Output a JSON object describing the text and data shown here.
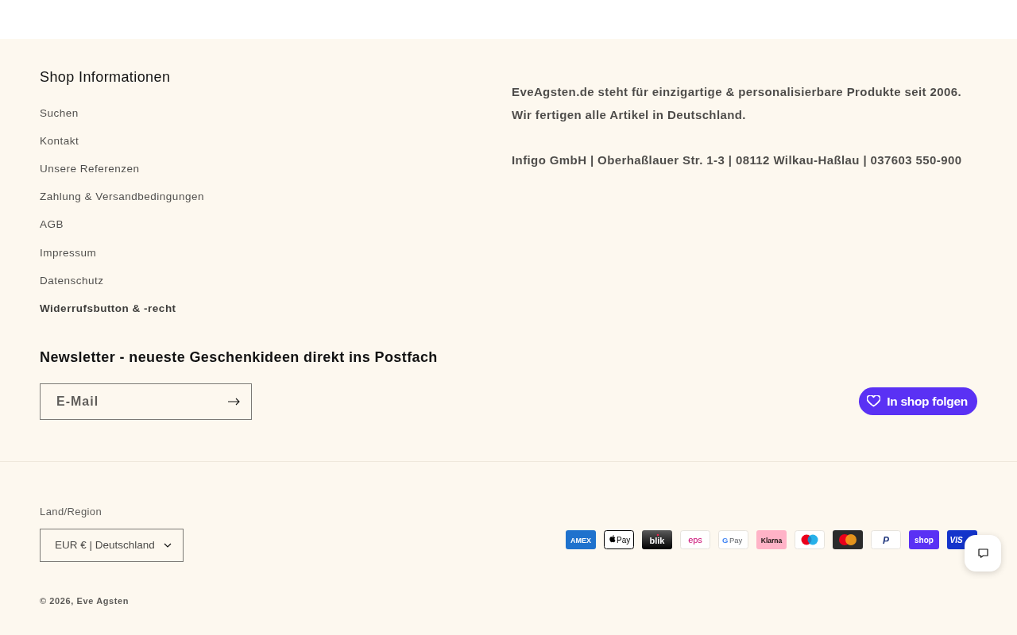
{
  "shop_info": {
    "heading": "Shop Informationen",
    "links": [
      {
        "label": "Suchen",
        "bold": false
      },
      {
        "label": "Kontakt",
        "bold": false
      },
      {
        "label": "Unsere Referenzen",
        "bold": false
      },
      {
        "label": "Zahlung & Versandbedingungen",
        "bold": false
      },
      {
        "label": "AGB",
        "bold": false
      },
      {
        "label": "Impressum",
        "bold": false
      },
      {
        "label": "Datenschutz",
        "bold": false
      },
      {
        "label": "Widerrufsbutton & -recht",
        "bold": true
      }
    ]
  },
  "about": {
    "lines": [
      "EveAgsten.de steht für einzigartige & personalisierbare Produkte seit 2006.",
      "Wir fertigen alle Artikel in Deutschland."
    ],
    "address": "Infigo GmbH | Oberhaßlauer Str. 1-3 | 08112 Wilkau-Haßlau | 037603 550-900"
  },
  "newsletter": {
    "heading": "Newsletter - neueste Geschenkideen direkt ins Postfach",
    "email_field": {
      "placeholder": "E-Mail"
    }
  },
  "follow_button": {
    "label": "In shop folgen"
  },
  "region": {
    "label": "Land/Region",
    "value": "EUR € | Deutschland"
  },
  "payment_methods": [
    {
      "kind": "amex",
      "label": "AMEX"
    },
    {
      "kind": "applepay",
      "label": "Pay"
    },
    {
      "kind": "blik",
      "label": "blik"
    },
    {
      "kind": "eps",
      "label": "eps"
    },
    {
      "kind": "googlepay",
      "mark": "G",
      "label": "Pay"
    },
    {
      "kind": "klarna",
      "label": "Klarna"
    },
    {
      "kind": "maestro"
    },
    {
      "kind": "mastercard"
    },
    {
      "kind": "paypal",
      "label": "P"
    },
    {
      "kind": "shoppay",
      "label": "shop"
    },
    {
      "kind": "visa",
      "label": "VIS"
    }
  ],
  "copyright": {
    "text": "© 2026,",
    "link": "Eve Agsten"
  }
}
